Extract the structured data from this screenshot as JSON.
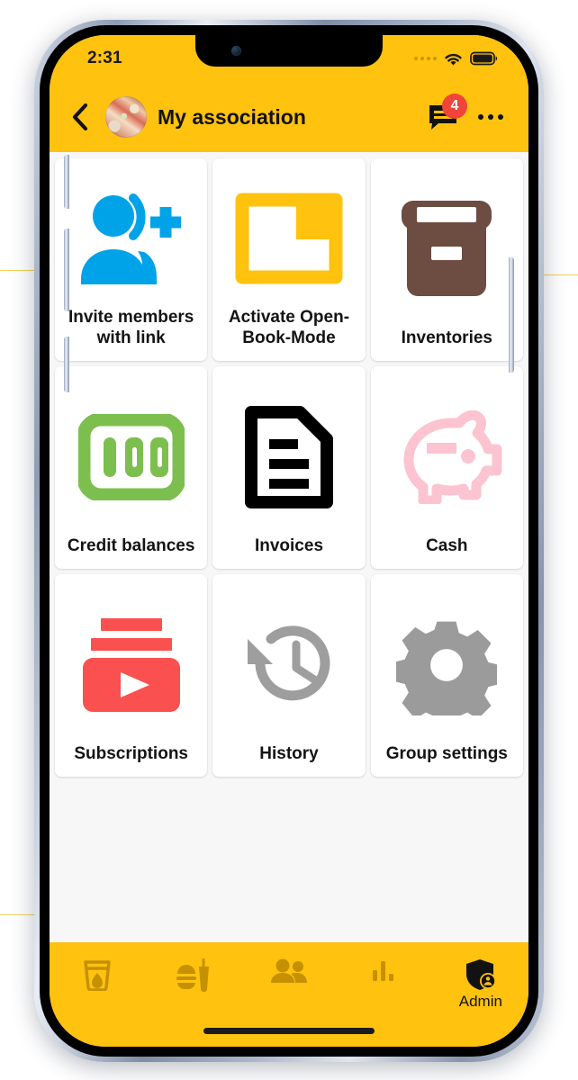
{
  "status_bar": {
    "time": "2:31",
    "icons": [
      "signal-dots",
      "wifi-icon",
      "battery-icon"
    ]
  },
  "header": {
    "back_icon": "chevron-left-icon",
    "avatar_icon": "group-avatar",
    "title": "My association",
    "chat_icon": "chat-bubble-icon",
    "chat_badge": "4",
    "overflow_icon": "more-horizontal-icon"
  },
  "grid": {
    "tiles": [
      {
        "label": "Invite members with link",
        "icon": "person-add-icon",
        "color": "#00a3e8"
      },
      {
        "label": "Activate Open-Book-Mode",
        "icon": "open-folder-icon",
        "color": "#ffc20e"
      },
      {
        "label": "Inventories",
        "icon": "archive-box-icon",
        "color": "#6d4c41"
      },
      {
        "label": "Credit balances",
        "icon": "money-100-icon",
        "color": "#7cbf4e"
      },
      {
        "label": "Invoices",
        "icon": "document-lines-icon",
        "color": "#000000"
      },
      {
        "label": "Cash",
        "icon": "piggy-bank-icon",
        "color": "#fcc4d0"
      },
      {
        "label": "Subscriptions",
        "icon": "video-subscriptions-icon",
        "color": "#fb5050"
      },
      {
        "label": "History",
        "icon": "clock-rotate-left-icon",
        "color": "#9e9e9e"
      },
      {
        "label": "Group settings",
        "icon": "gear-icon",
        "color": "#9b9b9b"
      }
    ]
  },
  "bottom_nav": {
    "items": [
      {
        "label": "",
        "icon": "drink-cup-icon",
        "active": false
      },
      {
        "label": "",
        "icon": "fast-food-icon",
        "active": false
      },
      {
        "label": "",
        "icon": "people-icon",
        "active": false
      },
      {
        "label": "",
        "icon": "bar-chart-icon",
        "active": false
      },
      {
        "label": "Admin",
        "icon": "shield-admin-icon",
        "active": true
      }
    ]
  },
  "theme": {
    "accent": "#ffc20e",
    "nav_inactive": "#c59103",
    "nav_active": "#121212",
    "badge": "#f04438",
    "screen_bg": "#f7f7f7",
    "tile_bg": "#ffffff"
  }
}
